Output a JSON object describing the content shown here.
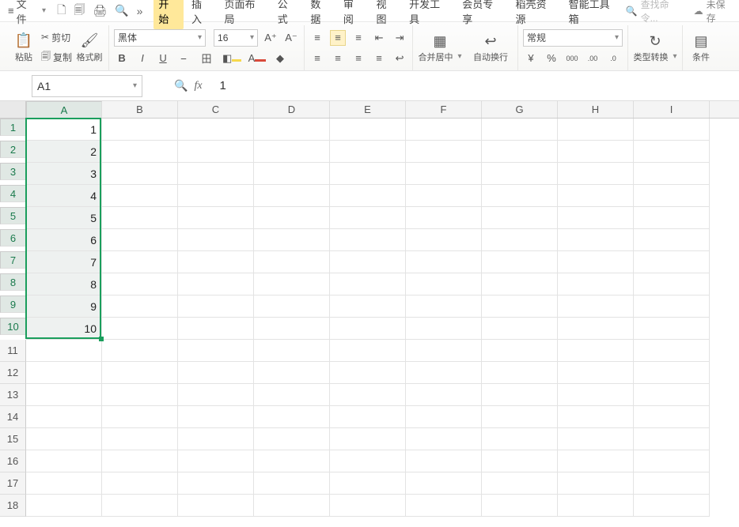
{
  "menu": {
    "hamburger": "≡",
    "file": "文件",
    "icons": [
      "🗋",
      "🗐",
      "🖨",
      "🔍"
    ],
    "more": "»",
    "tabs": [
      "开始",
      "插入",
      "页面布局",
      "公式",
      "数据",
      "审阅",
      "视图",
      "开发工具",
      "会员专享",
      "稻壳资源",
      "智能工具箱"
    ],
    "active_tab": 0,
    "search_icon": "🔍",
    "search_placeholder": "查找命令...",
    "cloud_icon": "☁",
    "save_status": "未保存"
  },
  "ribbon": {
    "paste": {
      "icon": "📋",
      "label": "粘贴"
    },
    "cut": {
      "icon": "✂",
      "label": "剪切"
    },
    "copy": {
      "icon": "🗐",
      "label": "复制"
    },
    "format_paint": {
      "icon": "🖌",
      "label": "格式刷"
    },
    "font_name": "黑体",
    "font_size": "16",
    "inc_font": "A⁺",
    "dec_font": "A⁻",
    "bold": "B",
    "italic": "I",
    "underline": "U",
    "strike": "⎯",
    "border": "田",
    "fill": "◧",
    "fontcolor": "A",
    "highlight": "◆",
    "align": [
      "≡",
      "≡",
      "≡",
      "≡",
      "≡",
      "≡"
    ],
    "indent_dec": "⇤",
    "indent_inc": "⇥",
    "wrap": "↩",
    "merge": {
      "icon": "▦",
      "label": "合并居中"
    },
    "autowrap": {
      "icon": "↩",
      "label": "自动换行"
    },
    "num_format": "常规",
    "currency": "¥",
    "percent": "%",
    "comma": "000",
    "inc_dec": ".00",
    "dec_dec": ".0",
    "type_convert": {
      "icon": "↻",
      "label": "类型转换"
    },
    "cond_fmt": "条件"
  },
  "namebox": "A1",
  "formula": "1",
  "columns": [
    "A",
    "B",
    "C",
    "D",
    "E",
    "F",
    "G",
    "H",
    "I"
  ],
  "selected_col": 0,
  "row_count": 18,
  "selection": {
    "r1": 1,
    "r2": 10,
    "c": 0
  },
  "active": {
    "r": 1,
    "c": 0
  },
  "data": {
    "A": [
      "1",
      "2",
      "3",
      "4",
      "5",
      "6",
      "7",
      "8",
      "9",
      "10"
    ]
  }
}
